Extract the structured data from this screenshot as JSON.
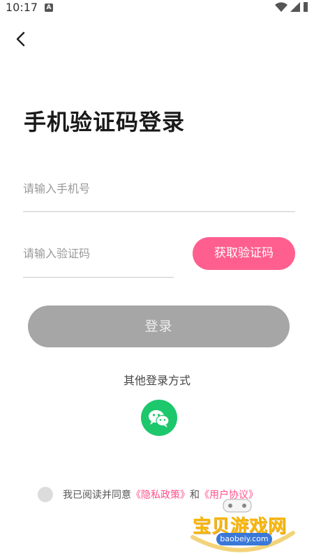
{
  "status_bar": {
    "time": "10:17",
    "notification_icon": "A"
  },
  "header": {
    "back_icon": "chevron-left-icon"
  },
  "page": {
    "title": "手机验证码登录"
  },
  "form": {
    "phone_placeholder": "请输入手机号",
    "code_placeholder": "请输入验证码",
    "get_code_label": "获取验证码",
    "login_label": "登录"
  },
  "other_login": {
    "label": "其他登录方式",
    "wechat_icon": "wechat-icon"
  },
  "agreement": {
    "prefix": "我已阅读并同意",
    "privacy_link": "《隐私政策》",
    "and": "和",
    "terms_link": "《用户协议》"
  },
  "watermark": {
    "text": "宝贝游戏网",
    "url": "baobeiy.com"
  },
  "colors": {
    "accent_pink": "#ff5f8f",
    "login_disabled": "#a6a6a6",
    "wechat_green": "#1dc76b"
  }
}
